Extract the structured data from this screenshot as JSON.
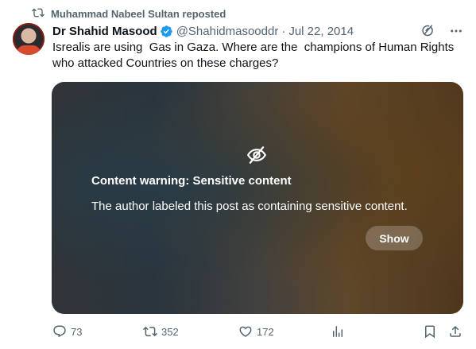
{
  "repost": {
    "label": "Muhammad Nabeel Sultan reposted",
    "icon": "repost-icon"
  },
  "author": {
    "name": "Dr Shahid Masood",
    "handle": "@Shahidmasooddr",
    "separator": "·",
    "date": "Jul 22, 2014",
    "verified_color": "#1d9bf0"
  },
  "post": {
    "text": "Isrealis are using  Gas in Gaza. Where are the  champions of Human Rights who attacked Countries on these charges?"
  },
  "media": {
    "warning_title": "Content warning: Sensitive content",
    "warning_text": "The author labeled this post as containing sensitive content.",
    "show_label": "Show",
    "icon": "eye-slash-icon"
  },
  "actions": {
    "replies": "73",
    "reposts": "352",
    "likes": "172"
  },
  "colors": {
    "text_primary": "#0f1419",
    "text_secondary": "#536471",
    "accent": "#1d9bf0"
  }
}
